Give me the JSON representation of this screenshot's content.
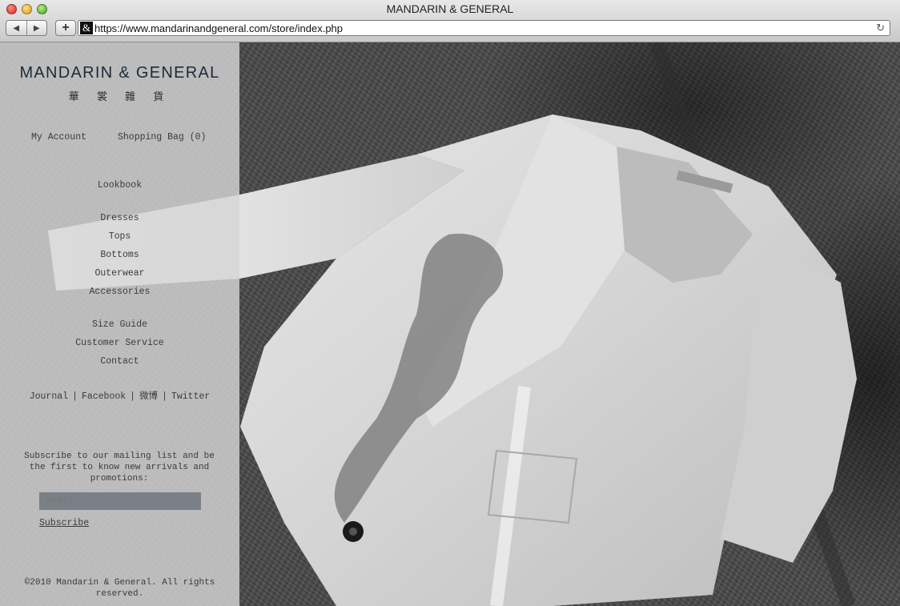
{
  "window": {
    "title": "MANDARIN & GENERAL",
    "url": "https://www.mandarinandgeneral.com/store/index.php"
  },
  "sidebar": {
    "logo": "MANDARIN & GENERAL",
    "logo_cn": "華 裳 雜 貨",
    "account": {
      "my_account": "My Account",
      "shopping_bag": "Shopping Bag (0)"
    },
    "lookbook": "Lookbook",
    "categories": [
      "Dresses",
      "Tops",
      "Bottoms",
      "Outerwear",
      "Accessories"
    ],
    "info": [
      "Size Guide",
      "Customer Service",
      "Contact"
    ],
    "social": [
      "Journal",
      "Facebook",
      "微博",
      "Twitter"
    ],
    "separator": "|",
    "subscribe": {
      "text": "Subscribe to our mailing list and be the first to know new arrivals and promotions:",
      "placeholder": "email",
      "button": "Subscribe"
    },
    "copyright": "©2010 Mandarin & General. All rights reserved."
  },
  "colors": {
    "logo": "#1d2a38",
    "text": "#3a3a3a",
    "input_bg": "#7a8088"
  }
}
